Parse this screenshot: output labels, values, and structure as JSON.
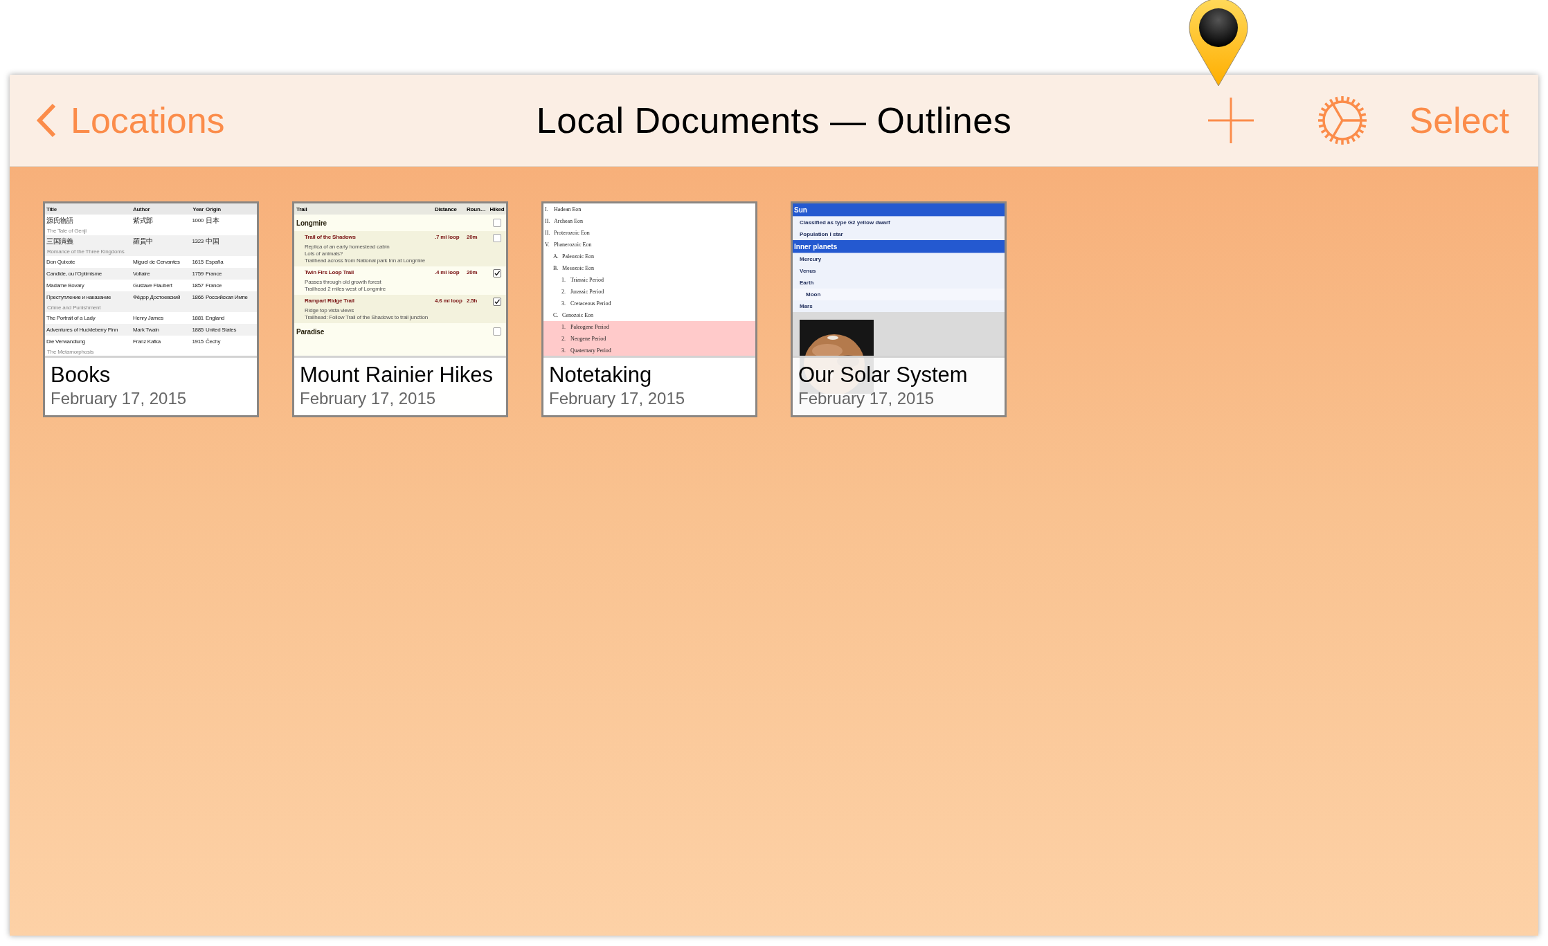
{
  "nav": {
    "back": "Locations",
    "title": "Local Documents — Outlines",
    "action": "Select"
  },
  "cards": [
    {
      "name": "Books",
      "date": "February 17, 2015",
      "preview": {
        "kind": "table",
        "columns": [
          "Title",
          "Author",
          "Year",
          "Origin"
        ],
        "rows": [
          {
            "title": "源氏物語",
            "author": "紫式部",
            "year": "1000",
            "origin": "日本",
            "note": "The Tale of Genji"
          },
          {
            "title": "三国演義",
            "author": "羅貫中",
            "year": "1323",
            "origin": "中国",
            "note": "Romance of the Three Kingdoms"
          },
          {
            "title": "Don Quixote",
            "author": "Miguel de Cervantes",
            "year": "1615",
            "origin": "España"
          },
          {
            "title": "Candide, ou l'Optimisme",
            "author": "Voltaire",
            "year": "1759",
            "origin": "France"
          },
          {
            "title": "Madame Bovary",
            "author": "Gustave Flaubert",
            "year": "1857",
            "origin": "France"
          },
          {
            "title": "Преступление и наказание",
            "author": "Фёдор Достоевский",
            "year": "1866",
            "origin": "Российская Импе",
            "note": "Crime and Punishment"
          },
          {
            "title": "The Portrait of a Lady",
            "author": "Henry James",
            "year": "1881",
            "origin": "England"
          },
          {
            "title": "Adventures of Huckleberry Finn",
            "author": "Mark Twain",
            "year": "1885",
            "origin": "United States"
          },
          {
            "title": "Die Verwandlung",
            "author": "Franz Kafka",
            "year": "1915",
            "origin": "Čechy",
            "note": "The Metamorphosis"
          }
        ]
      }
    },
    {
      "name": "Mount Rainier Hikes",
      "date": "February 17, 2015",
      "preview": {
        "kind": "trails",
        "columns": [
          "Trail",
          "Distance",
          "Roun…",
          "Hiked"
        ],
        "groups": [
          {
            "name": "Longmire",
            "hiked": false,
            "trails": [
              {
                "name": "Trail of the Shadows",
                "distance": ".7 mi loop",
                "time": "20m",
                "hiked": false,
                "notes": [
                  "Replica of an early homestead cabin",
                  "Lots of animals?",
                  "Trailhead across from National park Inn at Longmire"
                ]
              },
              {
                "name": "Twin Firs Loop Trail",
                "distance": ".4 mi loop",
                "time": "20m",
                "hiked": true,
                "notes": [
                  "Passes through old growth forest",
                  "Trailhead 2 miles west of Longmire"
                ]
              },
              {
                "name": "Rampart Ridge Trail",
                "distance": "4.6 mi loop",
                "time": "2.5h",
                "hiked": true,
                "notes": [
                  "Ridge top vista views",
                  "Trailhead: Follow Trail of the Shadows to trail junction"
                ]
              }
            ]
          },
          {
            "name": "Paradise",
            "hiked": false
          }
        ]
      }
    },
    {
      "name": "Notetaking",
      "date": "February 17, 2015",
      "preview": {
        "kind": "outline",
        "items": [
          {
            "label": "I.",
            "text": "Hadean Eon",
            "highlighted": false
          },
          {
            "label": "II.",
            "text": "Archean Eon",
            "highlighted": false
          },
          {
            "label": "II.",
            "text": "Proterozoic Eon",
            "highlighted": false
          },
          {
            "label": "V.",
            "text": "Phanerozoic Eon",
            "highlighted": false,
            "children": [
              {
                "label": "A.",
                "text": "Paleozoic Eon",
                "highlighted": false
              },
              {
                "label": "B.",
                "text": "Mesozoic Eon",
                "highlighted": false,
                "children": [
                  {
                    "label": "1.",
                    "text": "Triassic Period",
                    "highlighted": false
                  },
                  {
                    "label": "2.",
                    "text": "Jurassic Period",
                    "highlighted": false
                  },
                  {
                    "label": "3.",
                    "text": "Cretaceous Period",
                    "highlighted": false
                  }
                ]
              },
              {
                "label": "C.",
                "text": "Cenozoic Eon",
                "highlighted": false,
                "children": [
                  {
                    "label": "1.",
                    "text": "Paleogene Period",
                    "highlighted": true
                  },
                  {
                    "label": "2.",
                    "text": "Neogene Period",
                    "highlighted": true
                  },
                  {
                    "label": "3.",
                    "text": "Quaternary Period",
                    "highlighted": true
                  }
                ]
              }
            ]
          }
        ]
      }
    },
    {
      "name": "Our Solar System",
      "date": "February 17, 2015",
      "preview": {
        "kind": "styled-outline",
        "items": [
          {
            "kind": "heading",
            "text": "Sun",
            "children": [
              {
                "kind": "item",
                "text": "Classified as type G2 yellow dwarf"
              },
              {
                "kind": "item",
                "text": "Population I star"
              }
            ]
          },
          {
            "kind": "heading",
            "text": "Inner planets",
            "children": [
              {
                "kind": "item",
                "text": "Mercury"
              },
              {
                "kind": "item",
                "text": "Venus"
              },
              {
                "kind": "item",
                "text": "Earth",
                "children": [
                  {
                    "kind": "item",
                    "text": "Moon"
                  }
                ]
              },
              {
                "kind": "item",
                "text": "Mars"
              }
            ]
          }
        ]
      }
    }
  ]
}
